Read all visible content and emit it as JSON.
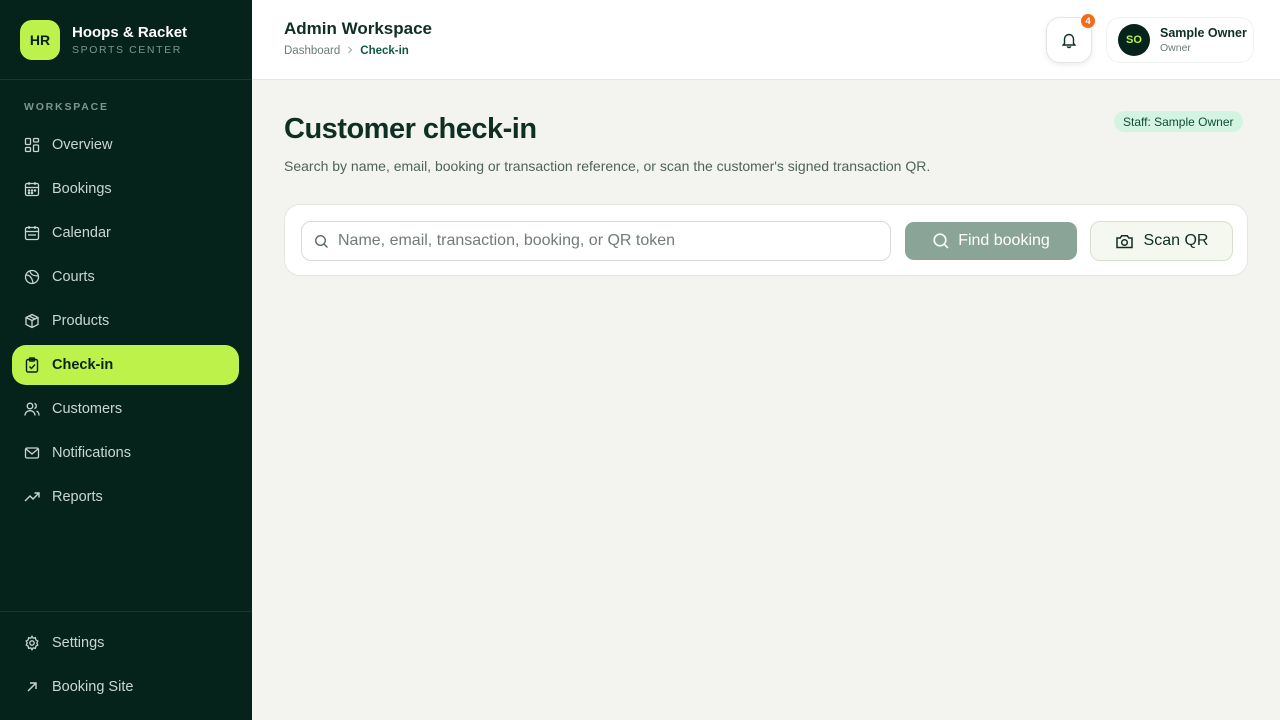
{
  "brand": {
    "initials": "HR",
    "name": "Hoops & Racket",
    "subtitle": "SPORTS CENTER"
  },
  "sidebar": {
    "section_label": "WORKSPACE",
    "items": [
      {
        "label": "Overview",
        "icon": "grid-icon"
      },
      {
        "label": "Bookings",
        "icon": "calendar-icon"
      },
      {
        "label": "Calendar",
        "icon": "calendar-icon"
      },
      {
        "label": "Courts",
        "icon": "ball-icon"
      },
      {
        "label": "Products",
        "icon": "box-icon"
      },
      {
        "label": "Check-in",
        "icon": "clipboard-check-icon",
        "active": true
      },
      {
        "label": "Customers",
        "icon": "users-icon"
      },
      {
        "label": "Notifications",
        "icon": "mail-icon"
      },
      {
        "label": "Reports",
        "icon": "trend-icon"
      }
    ],
    "footer": [
      {
        "label": "Settings",
        "icon": "gear-icon"
      },
      {
        "label": "Booking Site",
        "icon": "external-arrow-icon"
      }
    ]
  },
  "header": {
    "title": "Admin Workspace",
    "breadcrumb": [
      "Dashboard",
      "Check-in"
    ],
    "notification_count": "4",
    "user": {
      "initials": "SO",
      "name": "Sample Owner",
      "role": "Owner"
    }
  },
  "main": {
    "title": "Customer check-in",
    "staff_badge": "Staff: Sample Owner",
    "subtitle": "Search by name, email, booking or transaction reference, or scan the customer's signed transaction QR.",
    "search": {
      "placeholder": "Name, email, transaction, booking, or QR token",
      "value": ""
    },
    "find_button": "Find booking",
    "scan_button": "Scan QR"
  },
  "colors": {
    "sidebar_bg": "#06231b",
    "accent": "#bdf24a",
    "badge": "#f26a1b",
    "find_button": "#8aa598"
  }
}
